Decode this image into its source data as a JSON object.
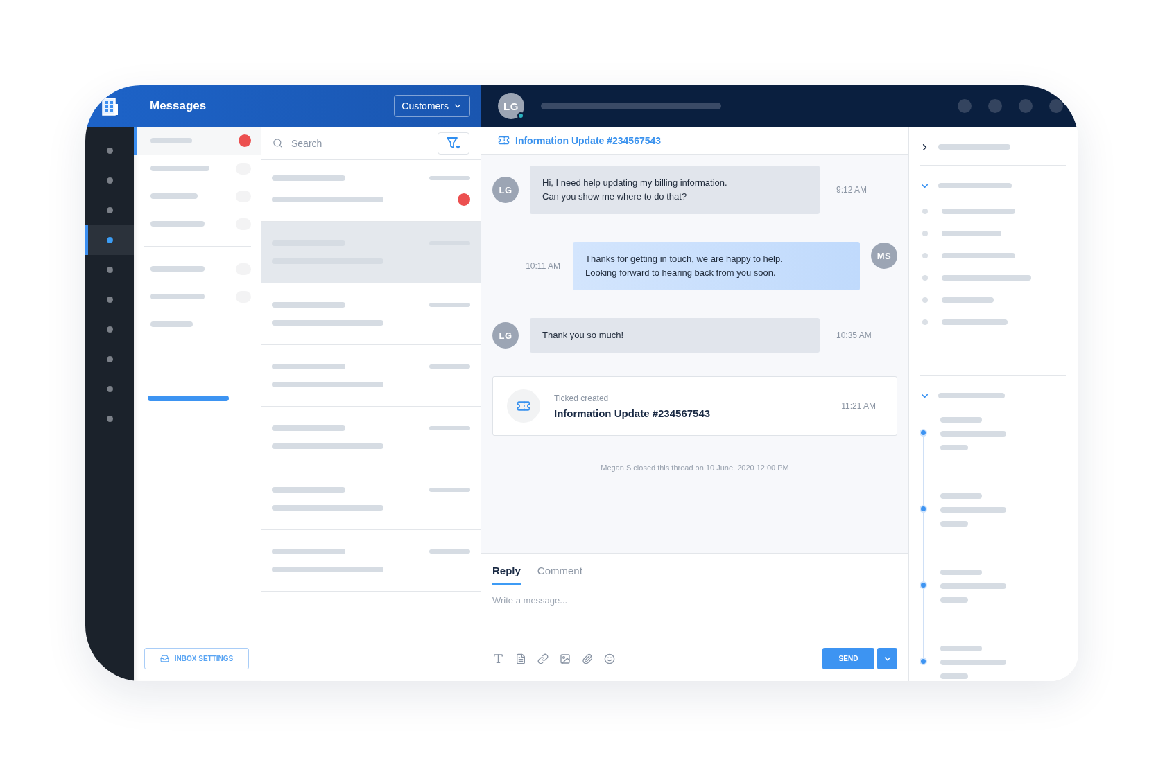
{
  "header": {
    "title": "Messages",
    "filter_dropdown": "Customers",
    "contact_avatar": {
      "initials": "LG",
      "online": true
    }
  },
  "rail": [
    {
      "selected": false
    },
    {
      "selected": false
    },
    {
      "selected": false
    },
    {
      "selected": true
    },
    {
      "selected": false
    },
    {
      "selected": false
    },
    {
      "selected": false
    },
    {
      "selected": false
    },
    {
      "selected": false
    },
    {
      "selected": false
    }
  ],
  "nav": {
    "groups": [
      [
        {
          "selected": true,
          "unread": true,
          "count_pill": false
        },
        {
          "selected": false,
          "unread": false,
          "count_pill": true
        },
        {
          "selected": false,
          "unread": false,
          "count_pill": true
        },
        {
          "selected": false,
          "unread": false,
          "count_pill": true
        }
      ],
      [
        {
          "selected": false,
          "unread": false,
          "count_pill": true
        },
        {
          "selected": false,
          "unread": false,
          "count_pill": true
        },
        {
          "selected": false,
          "unread": false,
          "count_pill": false
        }
      ]
    ],
    "inbox_settings": "INBOX SETTINGS"
  },
  "search": {
    "placeholder": "Search"
  },
  "conversations": [
    {
      "selected": false,
      "unread": true
    },
    {
      "selected": true,
      "unread": false
    },
    {
      "selected": false,
      "unread": false
    },
    {
      "selected": false,
      "unread": false
    },
    {
      "selected": false,
      "unread": false
    },
    {
      "selected": false,
      "unread": false
    },
    {
      "selected": false,
      "unread": false
    }
  ],
  "thread": {
    "title": "Information Update #234567543",
    "messages": [
      {
        "kind": "customer",
        "initials": "LG",
        "text": "Hi, I need help updating my billing information.\nCan you show me where to do that?",
        "time": "9:12 AM"
      },
      {
        "kind": "agent",
        "initials": "MS",
        "text": "Thanks for getting in touch, we are happy to help.\nLooking forward to hearing back from you soon.",
        "time": "10:11 AM"
      },
      {
        "kind": "customer",
        "initials": "LG",
        "text": "Thank you so much!",
        "time": "10:35 AM"
      },
      {
        "kind": "ticket",
        "label": "Ticked created",
        "title": "Information Update #234567543",
        "time": "11:21 AM"
      }
    ],
    "closed_notice": "Megan S closed this thread on 10 June, 2020 12:00 PM"
  },
  "composer": {
    "tabs": [
      {
        "label": "Reply",
        "selected": true
      },
      {
        "label": "Comment",
        "selected": false
      }
    ],
    "placeholder": "Write a message...",
    "send": "SEND"
  },
  "details": {
    "sections": [
      {
        "kind": "summary",
        "expanded": false
      },
      {
        "kind": "list",
        "expanded": true
      },
      {
        "kind": "timeline",
        "expanded": true
      }
    ]
  }
}
